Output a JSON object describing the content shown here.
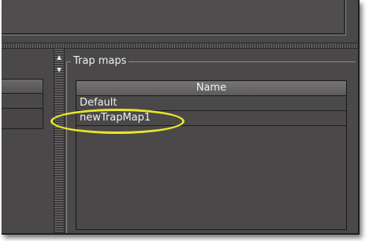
{
  "trap_maps": {
    "title": "Trap maps",
    "column_header": "Name",
    "rows": [
      {
        "name": "Default"
      },
      {
        "name": "newTrapMap1"
      }
    ]
  },
  "colors": {
    "panel_bg": "#4a4849",
    "highlight_ellipse": "#e8e62a",
    "text": "#f2f2f2"
  },
  "icons": [
    "up-arrow-icon",
    "down-arrow-icon"
  ]
}
